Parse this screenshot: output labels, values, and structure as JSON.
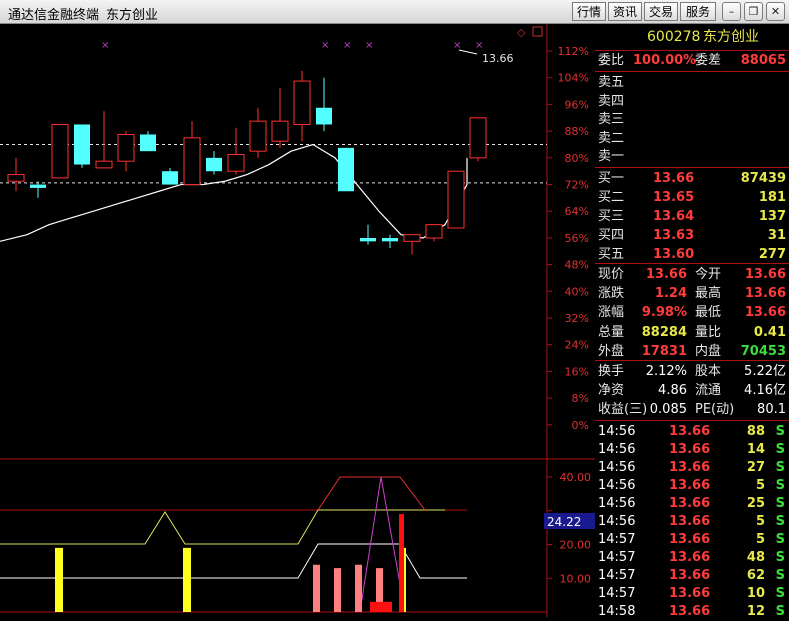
{
  "window": {
    "title": "通达信金融终端",
    "stock_name": "东方创业",
    "menu": [
      "行情",
      "资讯",
      "交易",
      "服务"
    ]
  },
  "chart": {
    "price_label": "13.66",
    "pct_ticks": [
      "112%",
      "104%",
      "96%",
      "88%",
      "80%",
      "72%",
      "64%",
      "56%",
      "48%",
      "40%",
      "32%",
      "24%",
      "16%",
      "8%",
      "0%"
    ],
    "ind_ticks": [
      "40.00",
      "30.00",
      "20.00",
      "10.00"
    ],
    "ind_value": "24.22"
  },
  "chart_data": {
    "type": "candlestick",
    "candles": [
      {
        "o": 73,
        "h": 80,
        "l": 70,
        "c": 75
      },
      {
        "o": 72,
        "h": 73,
        "l": 68,
        "c": 71
      },
      {
        "o": 74,
        "h": 90,
        "l": 74,
        "c": 90
      },
      {
        "o": 90,
        "h": 90,
        "l": 77,
        "c": 78
      },
      {
        "o": 77,
        "h": 94,
        "l": 77,
        "c": 79
      },
      {
        "o": 79,
        "h": 88,
        "l": 76,
        "c": 87
      },
      {
        "o": 87,
        "h": 88,
        "l": 83,
        "c": 82
      },
      {
        "o": 76,
        "h": 77,
        "l": 72,
        "c": 72
      },
      {
        "o": 72,
        "h": 91,
        "l": 72,
        "c": 86
      },
      {
        "o": 80,
        "h": 82,
        "l": 75,
        "c": 76
      },
      {
        "o": 76,
        "h": 89,
        "l": 75,
        "c": 81
      },
      {
        "o": 82,
        "h": 95,
        "l": 80,
        "c": 91
      },
      {
        "o": 85,
        "h": 101,
        "l": 83,
        "c": 91
      },
      {
        "o": 90,
        "h": 106,
        "l": 85,
        "c": 103
      },
      {
        "o": 95,
        "h": 104,
        "l": 88,
        "c": 90
      },
      {
        "o": 83,
        "h": 83,
        "l": 70,
        "c": 70
      },
      {
        "o": 56,
        "h": 60,
        "l": 54,
        "c": 55
      },
      {
        "o": 56,
        "h": 57,
        "l": 53,
        "c": 55
      },
      {
        "o": 55,
        "h": 57,
        "l": 51,
        "c": 57
      },
      {
        "o": 56,
        "h": 60,
        "l": 55,
        "c": 60
      },
      {
        "o": 59,
        "h": 76,
        "l": 59,
        "c": 76
      },
      {
        "o": 80,
        "h": 92,
        "l": 79,
        "c": 92
      }
    ],
    "ma": [
      55,
      57,
      60,
      62,
      64,
      66,
      68,
      70,
      72,
      72,
      73,
      75,
      78,
      82,
      84,
      80,
      72,
      64,
      57,
      56,
      60,
      72,
      80
    ],
    "ref_lines": [
      84,
      72.5
    ],
    "ylim": [
      0,
      116
    ],
    "indicator_bars": [
      {
        "pos": 2,
        "v": 19,
        "color": "yellow"
      },
      {
        "pos": 8,
        "v": 19,
        "color": "yellow"
      },
      {
        "pos": 14,
        "v": 14,
        "color": "pink"
      },
      {
        "pos": 15,
        "v": 13,
        "color": "pink"
      },
      {
        "pos": 16,
        "v": 14,
        "color": "pink"
      },
      {
        "pos": 17,
        "v": 13,
        "color": "pink"
      },
      {
        "pos": 18,
        "v": 3,
        "color": "red"
      },
      {
        "pos": 19,
        "v": 19,
        "color": "yellow"
      },
      {
        "pos": 19.1,
        "v": 29,
        "color": "red"
      }
    ]
  },
  "quote": {
    "code": "600278",
    "name": "东方创业",
    "weibi_label": "委比",
    "weibi_value": "100.00%",
    "weicha_label": "委差",
    "weicha_value": "88065",
    "asks": [
      {
        "label": "卖五",
        "price": "",
        "vol": ""
      },
      {
        "label": "卖四",
        "price": "",
        "vol": ""
      },
      {
        "label": "卖三",
        "price": "",
        "vol": ""
      },
      {
        "label": "卖二",
        "price": "",
        "vol": ""
      },
      {
        "label": "卖一",
        "price": "",
        "vol": ""
      }
    ],
    "bids": [
      {
        "label": "买一",
        "price": "13.66",
        "vol": "87439"
      },
      {
        "label": "买二",
        "price": "13.65",
        "vol": "181"
      },
      {
        "label": "买三",
        "price": "13.64",
        "vol": "137"
      },
      {
        "label": "买四",
        "price": "13.63",
        "vol": "31"
      },
      {
        "label": "买五",
        "price": "13.60",
        "vol": "277"
      }
    ],
    "stats": [
      {
        "l1": "现价",
        "v1": "13.66",
        "c1": "red",
        "l2": "今开",
        "v2": "13.66",
        "c2": "red"
      },
      {
        "l1": "涨跌",
        "v1": "1.24",
        "c1": "red",
        "l2": "最高",
        "v2": "13.66",
        "c2": "red"
      },
      {
        "l1": "涨幅",
        "v1": "9.98%",
        "c1": "red",
        "l2": "最低",
        "v2": "13.66",
        "c2": "red"
      },
      {
        "l1": "总量",
        "v1": "88284",
        "c1": "yel",
        "l2": "量比",
        "v2": "0.41",
        "c2": "yel"
      },
      {
        "l1": "外盘",
        "v1": "17831",
        "c1": "red",
        "l2": "内盘",
        "v2": "70453",
        "c2": "grn"
      }
    ],
    "fund": [
      {
        "l1": "换手",
        "v1": "2.12%",
        "l2": "股本",
        "v2": "5.22亿"
      },
      {
        "l1": "净资",
        "v1": "4.86",
        "l2": "流通",
        "v2": "4.16亿"
      },
      {
        "l1": "收益(三)",
        "v1": "0.085",
        "l2": "PE(动)",
        "v2": "80.1"
      }
    ],
    "ticks": [
      {
        "time": "14:56",
        "price": "13.66",
        "vol": "88",
        "flag": "S"
      },
      {
        "time": "14:56",
        "price": "13.66",
        "vol": "14",
        "flag": "S"
      },
      {
        "time": "14:56",
        "price": "13.66",
        "vol": "27",
        "flag": "S"
      },
      {
        "time": "14:56",
        "price": "13.66",
        "vol": "5",
        "flag": "S"
      },
      {
        "time": "14:56",
        "price": "13.66",
        "vol": "25",
        "flag": "S"
      },
      {
        "time": "14:56",
        "price": "13.66",
        "vol": "5",
        "flag": "S"
      },
      {
        "time": "14:57",
        "price": "13.66",
        "vol": "5",
        "flag": "S"
      },
      {
        "time": "14:57",
        "price": "13.66",
        "vol": "48",
        "flag": "S"
      },
      {
        "time": "14:57",
        "price": "13.66",
        "vol": "62",
        "flag": "S"
      },
      {
        "time": "14:57",
        "price": "13.66",
        "vol": "10",
        "flag": "S"
      },
      {
        "time": "14:58",
        "price": "13.66",
        "vol": "12",
        "flag": "S"
      }
    ]
  }
}
